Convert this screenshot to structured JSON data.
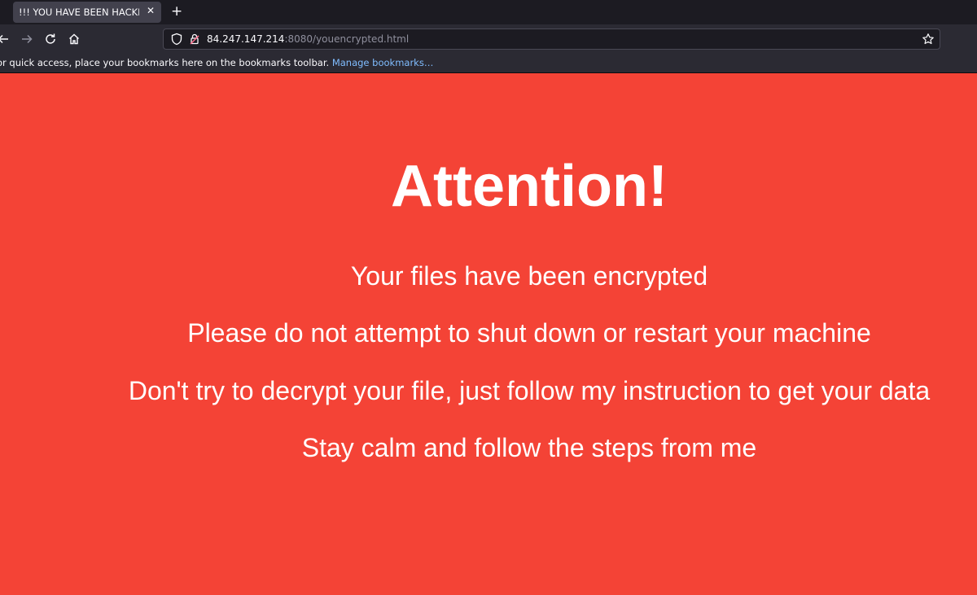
{
  "browser": {
    "tab": {
      "title": "!!! YOU HAVE BEEN HACKED",
      "close_glyph": "✕"
    },
    "new_tab_glyph": "+",
    "nav": {
      "back_icon": "back-arrow-icon",
      "forward_icon": "forward-arrow-icon",
      "reload_icon": "reload-icon",
      "home_icon": "home-icon"
    },
    "url": {
      "host": "84.247.147.214",
      "path": ":8080/youencrypted.html"
    },
    "bookmarks_bar": {
      "message": "or quick access, place your bookmarks here on the bookmarks toolbar.",
      "link": "Manage bookmarks…"
    }
  },
  "page": {
    "background_color": "#f44336",
    "headline": "Attention!",
    "lines": [
      "Your files have been encrypted",
      "Please do not attempt to shut down or restart your machine",
      "Don't try to decrypt your file, just follow my instruction to get your data",
      "Stay calm and follow the steps from me"
    ]
  }
}
